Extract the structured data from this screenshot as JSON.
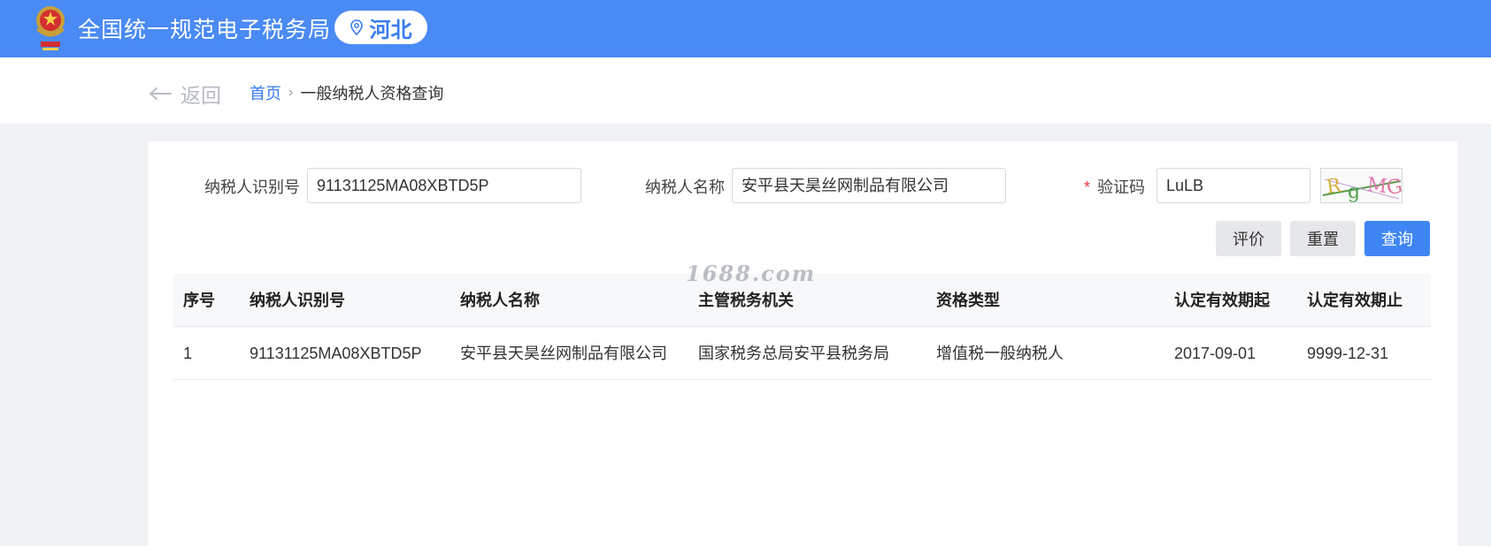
{
  "header": {
    "site_title": "全国统一规范电子税务局",
    "region": "河北",
    "emblem_icon": "tax-emblem-icon",
    "brand_color": "#4a8af4"
  },
  "nav": {
    "back_label": "返回",
    "breadcrumb": {
      "home": "首页",
      "separator": "›",
      "current": "一般纳税人资格查询"
    }
  },
  "form": {
    "taxpayer_id_label": "纳税人识别号",
    "taxpayer_id_value": "91131125MA08XBTD5P",
    "taxpayer_name_label": "纳税人名称",
    "taxpayer_name_value": "安平县天昊丝网制品有限公司",
    "captcha_required_mark": "*",
    "captcha_label": "验证码",
    "captcha_value": "LuLB",
    "captcha_image_text": "RgMG"
  },
  "buttons": {
    "evaluate": "评价",
    "reset": "重置",
    "query": "查询"
  },
  "table": {
    "columns": [
      "序号",
      "纳税人识别号",
      "纳税人名称",
      "主管税务机关",
      "资格类型",
      "认定有效期起",
      "认定有效期止"
    ],
    "rows": [
      [
        "1",
        "91131125MA08XBTD5P",
        "安平县天昊丝网制品有限公司",
        "国家税务总局安平县税务局",
        "增值税一般纳税人",
        "2017-09-01",
        "9999-12-31"
      ]
    ]
  },
  "watermark": "1688.com"
}
